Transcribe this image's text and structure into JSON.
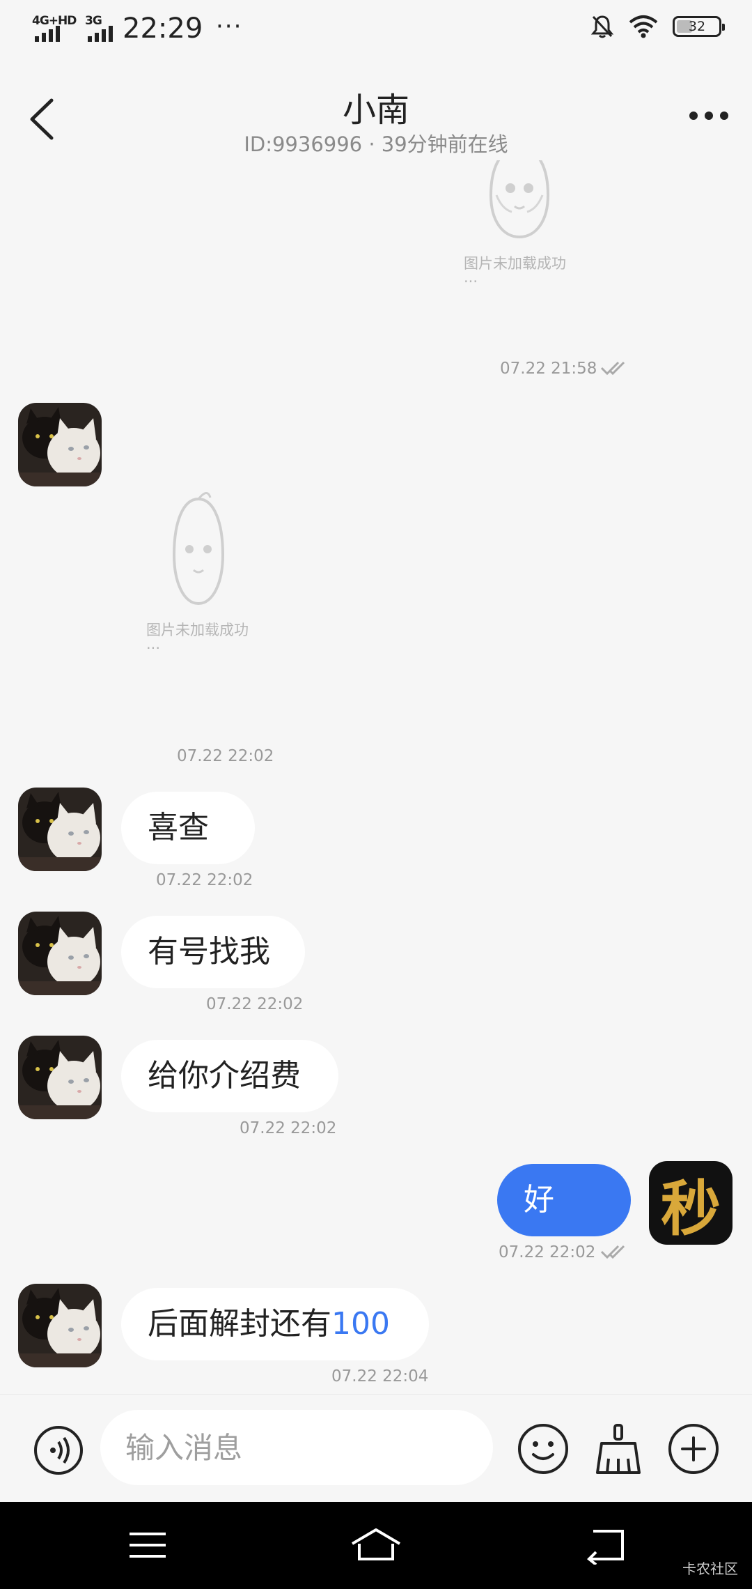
{
  "status_bar": {
    "network1": "4G+HD",
    "network2": "3G",
    "time": "22:29",
    "overflow": "···",
    "battery": "32",
    "icons": [
      "bell-off-icon",
      "wifi-icon",
      "battery-icon"
    ]
  },
  "header": {
    "title": "小南",
    "subtitle": "ID:9936996 · 39分钟前在线",
    "icons": [
      "back-icon",
      "more-icon"
    ]
  },
  "messages": [
    {
      "type": "image",
      "side": "out",
      "image_caption": "图片未加载成功···",
      "time": "07.22 21:58",
      "read": true
    },
    {
      "type": "image",
      "side": "in",
      "image_caption": "图片未加载成功···",
      "time": "07.22 22:02"
    },
    {
      "type": "text",
      "side": "in",
      "text": "喜查",
      "time": "07.22 22:02"
    },
    {
      "type": "text",
      "side": "in",
      "text": "有号找我",
      "time": "07.22 22:02"
    },
    {
      "type": "text",
      "side": "in",
      "text": "给你介绍费",
      "time": "07.22 22:02"
    },
    {
      "type": "text",
      "side": "out",
      "text": "好",
      "time": "07.22 22:02",
      "read": true
    },
    {
      "type": "text",
      "side": "in",
      "text": "后面解封还有",
      "text_highlight": "100",
      "time": "07.22 22:04"
    }
  ],
  "self_avatar_text": "秒",
  "input_bar": {
    "placeholder": "输入消息",
    "icons": [
      "voice-icon",
      "emoji-icon",
      "clean-broom-icon",
      "add-icon"
    ]
  },
  "nav_bar": {
    "icons": [
      "menu-icon",
      "home-icon",
      "back-icon"
    ]
  },
  "watermark": "卡农社区",
  "colors": {
    "accent": "#3a78f2",
    "background": "#f6f6f6",
    "bubble_in": "#ffffff"
  }
}
